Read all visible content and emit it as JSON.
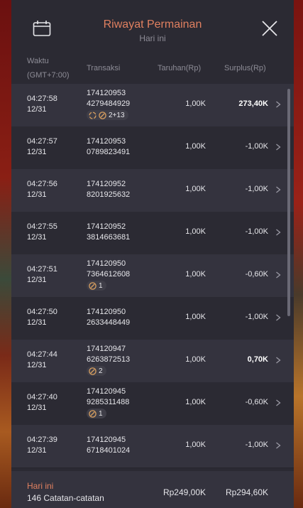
{
  "header": {
    "title": "Riwayat Permainan",
    "subtitle": "Hari ini",
    "calendar_icon": "calendar-icon",
    "close_icon": "close-icon"
  },
  "columns": {
    "time": "Waktu",
    "timezone": "(GMT+7:00)",
    "transaction": "Transaksi",
    "bet": "Taruhan(Rp)",
    "surplus": "Surplus(Rp)"
  },
  "rows": [
    {
      "time": "04:27:58",
      "date": "12/31",
      "tx1": "174120953",
      "tx2": "4279484929",
      "badge": "2+13",
      "badge_icons": [
        "respin-icon",
        "scatter-icon"
      ],
      "bet": "1,00K",
      "surplus": "273,40K",
      "positive": true
    },
    {
      "time": "04:27:57",
      "date": "12/31",
      "tx1": "174120953",
      "tx2": "0789823491",
      "badge": "",
      "bet": "1,00K",
      "surplus": "-1,00K",
      "positive": false
    },
    {
      "time": "04:27:56",
      "date": "12/31",
      "tx1": "174120952",
      "tx2": "8201925632",
      "badge": "",
      "bet": "1,00K",
      "surplus": "-1,00K",
      "positive": false
    },
    {
      "time": "04:27:55",
      "date": "12/31",
      "tx1": "174120952",
      "tx2": "3814663681",
      "badge": "",
      "bet": "1,00K",
      "surplus": "-1,00K",
      "positive": false
    },
    {
      "time": "04:27:51",
      "date": "12/31",
      "tx1": "174120950",
      "tx2": "7364612608",
      "badge": "1",
      "badge_icons": [
        "scatter-icon"
      ],
      "bet": "1,00K",
      "surplus": "-0,60K",
      "positive": false
    },
    {
      "time": "04:27:50",
      "date": "12/31",
      "tx1": "174120950",
      "tx2": "2633448449",
      "badge": "",
      "bet": "1,00K",
      "surplus": "-1,00K",
      "positive": false
    },
    {
      "time": "04:27:44",
      "date": "12/31",
      "tx1": "174120947",
      "tx2": "6263872513",
      "badge": "2",
      "badge_icons": [
        "scatter-icon"
      ],
      "bet": "1,00K",
      "surplus": "0,70K",
      "positive": true
    },
    {
      "time": "04:27:40",
      "date": "12/31",
      "tx1": "174120945",
      "tx2": "9285311488",
      "badge": "1",
      "badge_icons": [
        "scatter-icon"
      ],
      "bet": "1,00K",
      "surplus": "-0,60K",
      "positive": false
    },
    {
      "time": "04:27:39",
      "date": "12/31",
      "tx1": "174120945",
      "tx2": "6718401024",
      "badge": "",
      "bet": "1,00K",
      "surplus": "-1,00K",
      "positive": false
    }
  ],
  "footer": {
    "label": "Hari ini",
    "count": "146 Catatan-catatan",
    "total_bet": "Rp249,00K",
    "total_surplus": "Rp294,60K"
  },
  "colors": {
    "accent": "#e08060",
    "panel": "#2b2a33",
    "row_alt": "#34333e",
    "muted": "#8d8c96"
  }
}
